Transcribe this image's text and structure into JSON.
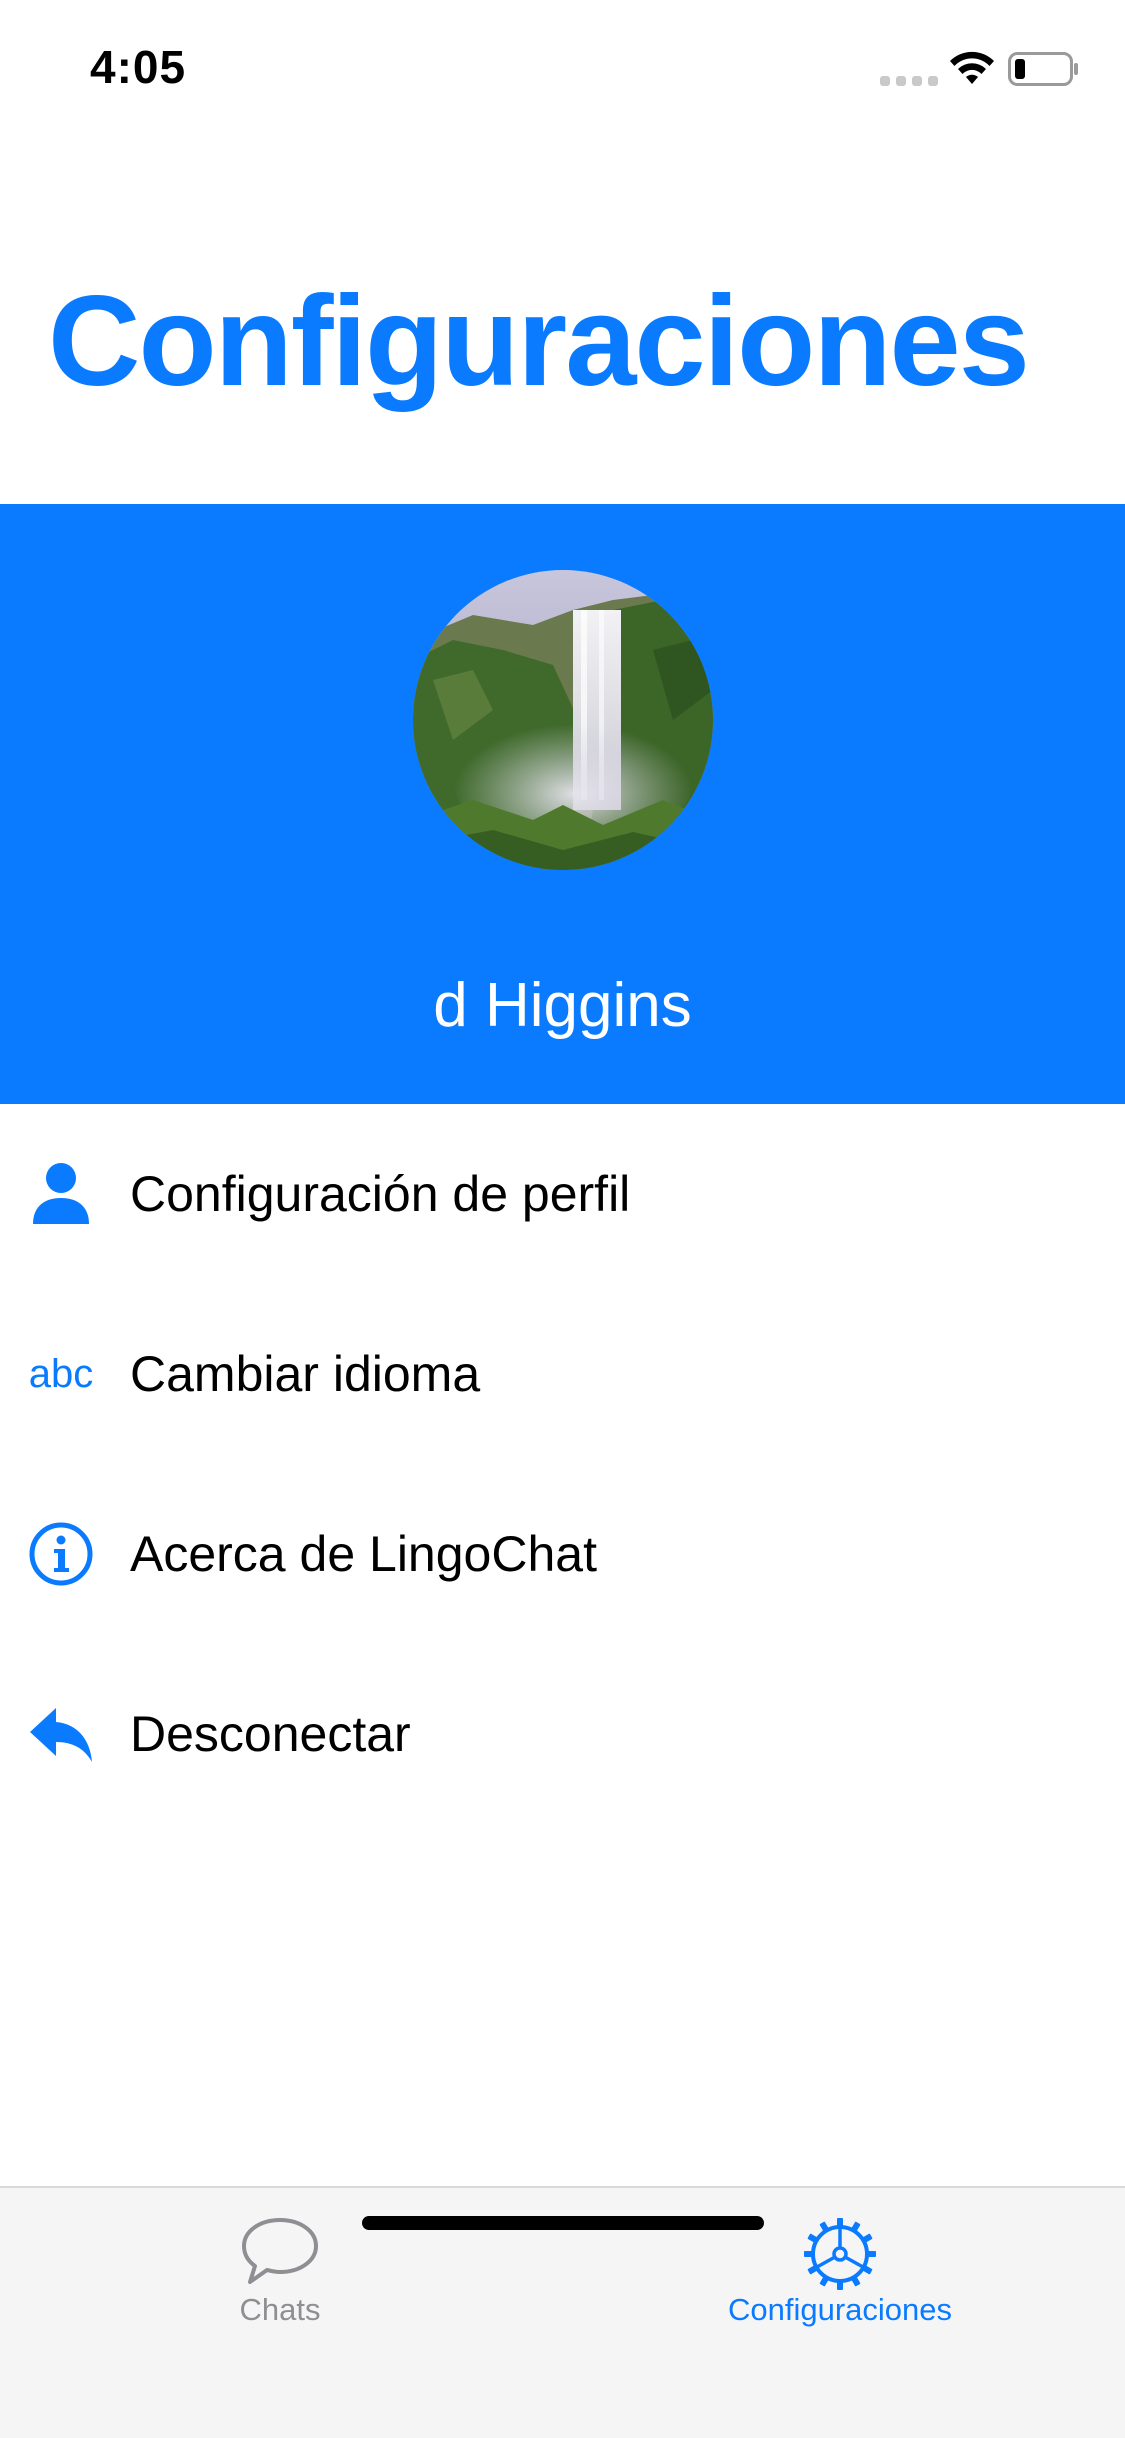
{
  "status_bar": {
    "time": "4:05"
  },
  "header": {
    "title": "Configuraciones"
  },
  "profile": {
    "name": "d Higgins"
  },
  "menu": {
    "items": [
      {
        "label": "Configuración de perfil",
        "icon": "person-icon"
      },
      {
        "label": "Cambiar idioma",
        "icon": "abc-icon",
        "icon_text": "abc"
      },
      {
        "label": "Acerca de LingoChat",
        "icon": "info-icon"
      },
      {
        "label": "Desconectar",
        "icon": "reply-icon"
      }
    ]
  },
  "tab_bar": {
    "tabs": [
      {
        "label": "Chats",
        "icon": "chat-bubble-icon",
        "selected": false
      },
      {
        "label": "Configuraciones",
        "icon": "gear-icon",
        "selected": true
      }
    ]
  },
  "colors": {
    "accent": "#0a7bff",
    "tab_inactive": "#8e8e93"
  }
}
